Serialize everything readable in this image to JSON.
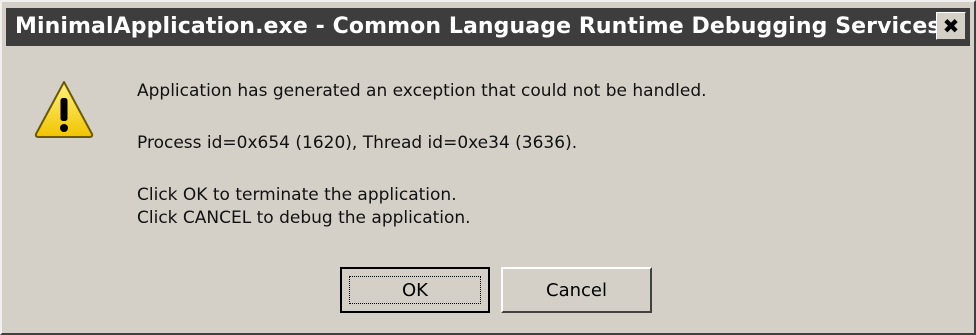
{
  "window": {
    "title": "MinimalApplication.exe - Common Language Runtime Debugging Services",
    "close_glyph": "✖"
  },
  "icon": "warning-icon",
  "messages": {
    "line1": "Application has generated an exception that could not be handled.",
    "line2": "Process id=0x654 (1620), Thread id=0xe34 (3636).",
    "line3": "Click OK to terminate the application.",
    "line4": "Click CANCEL to debug the application."
  },
  "buttons": {
    "ok_label": "OK",
    "cancel_label": "Cancel"
  },
  "colors": {
    "dialog_bg": "#d4d0c8",
    "titlebar_bg": "#3d3d3d",
    "warning_yellow": "#f5d800"
  }
}
